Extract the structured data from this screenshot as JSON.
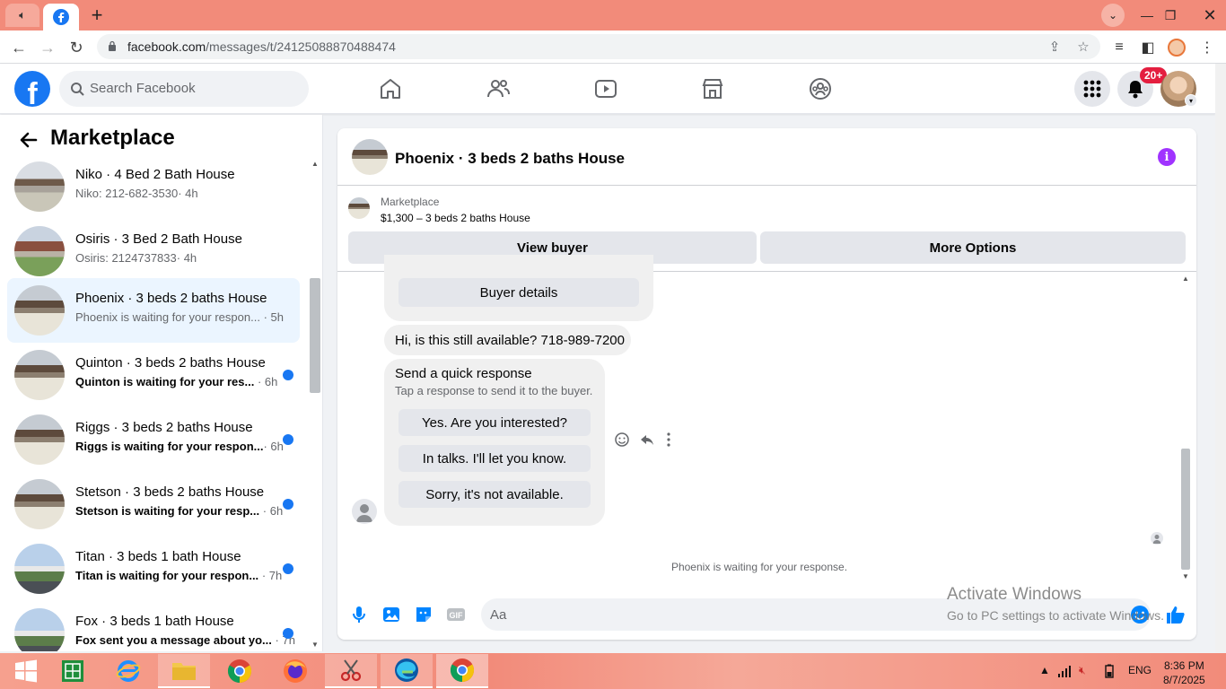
{
  "browser": {
    "url_host": "facebook.com",
    "url_path": "/messages/t/24125088870488474"
  },
  "header": {
    "search_placeholder": "Search Facebook",
    "notification_count": "20+"
  },
  "sidebar": {
    "title": "Marketplace",
    "conversations": [
      {
        "name": "Niko · 4 Bed 2 Bath House",
        "preview": "Niko: 212-682-3530",
        "time": "· 4h",
        "unread": false,
        "active": false
      },
      {
        "name": "Osiris · 3 Bed 2 Bath House",
        "preview": "Osiris: 2124737833",
        "time": "· 4h",
        "unread": false,
        "active": false
      },
      {
        "name": "Phoenix · 3 beds 2 baths House",
        "preview": "Phoenix is waiting for your respon...",
        "time": "· 5h",
        "unread": false,
        "active": true
      },
      {
        "name": "Quinton · 3 beds 2 baths House",
        "preview": "Quinton is waiting for your res...",
        "time": "· 6h",
        "unread": true,
        "active": false
      },
      {
        "name": "Riggs · 3 beds 2 baths House",
        "preview": "Riggs is waiting for your respon...",
        "time": "· 6h",
        "unread": true,
        "active": false
      },
      {
        "name": "Stetson · 3 beds 2 baths House",
        "preview": "Stetson is waiting for your resp...",
        "time": "· 6h",
        "unread": true,
        "active": false
      },
      {
        "name": "Titan · 3 beds 1 bath House",
        "preview": "Titan is waiting for your respon...",
        "time": "· 7h",
        "unread": true,
        "active": false
      },
      {
        "name": "Fox · 3 beds 1 bath House",
        "preview": "Fox sent you a message about yo...",
        "time": "· 7h",
        "unread": true,
        "active": false
      }
    ]
  },
  "chat": {
    "title": "Phoenix · 3 beds 2 baths House",
    "listing_source": "Marketplace",
    "listing_title": "$1,300 – 3 beds 2 baths House",
    "view_buyer_label": "View buyer",
    "more_options_label": "More Options",
    "buyer_details_label": "Buyer details",
    "buyer_message": "Hi, is this still available? 718-989-7200",
    "quick_response_title": "Send a quick response",
    "quick_response_sub": "Tap a response to send it to the buyer.",
    "quick_responses": [
      "Yes. Are you interested?",
      "In talks. I'll let you know.",
      "Sorry, it's not available."
    ],
    "status_text": "Phoenix is waiting for your response.",
    "input_placeholder": "Aa"
  },
  "watermark": {
    "line1": "Activate Windows",
    "line2": "Go to PC settings to activate Windows."
  },
  "taskbar": {
    "language": "ENG",
    "time": "8:36 PM",
    "date": "8/7/2025"
  }
}
